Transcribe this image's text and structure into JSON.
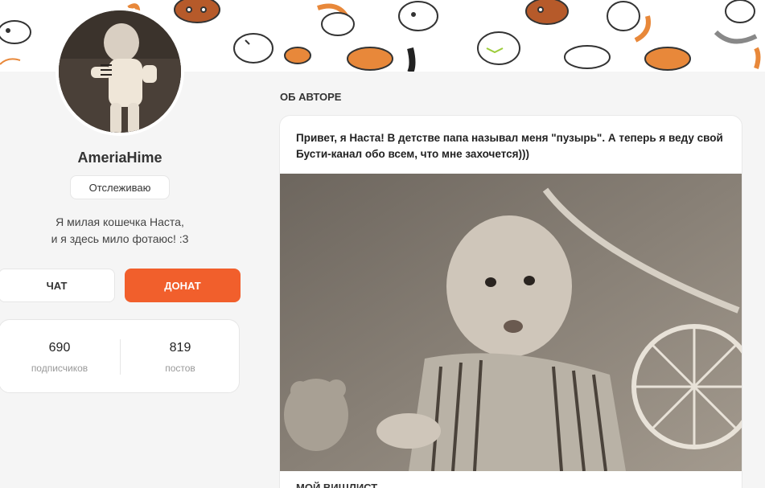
{
  "profile": {
    "username": "AmeriaHime",
    "follow_label": "Отслеживаю",
    "bio_lines": [
      "Я милая кошечка Наста,",
      "и я здесь мило фотаюс! :3"
    ],
    "avatar_icon": "baby-photo-avatar"
  },
  "actions": {
    "chat_label": "ЧАТ",
    "donate_label": "ДОНАТ"
  },
  "stats": {
    "subscribers_count": "690",
    "subscribers_label": "подписчиков",
    "posts_count": "819",
    "posts_label": "постов"
  },
  "about": {
    "section_title": "ОБ АВТОРЕ",
    "text": "Привет, я Наста! В детстве папа называл меня \"пузырь\". А теперь я веду свой Бусти-канал обо всем, что мне захочется)))",
    "next_section_title": "МОЙ ВИШЛИСТ"
  },
  "colors": {
    "accent": "#f15f2c",
    "background": "#f5f5f5",
    "card": "#ffffff"
  }
}
